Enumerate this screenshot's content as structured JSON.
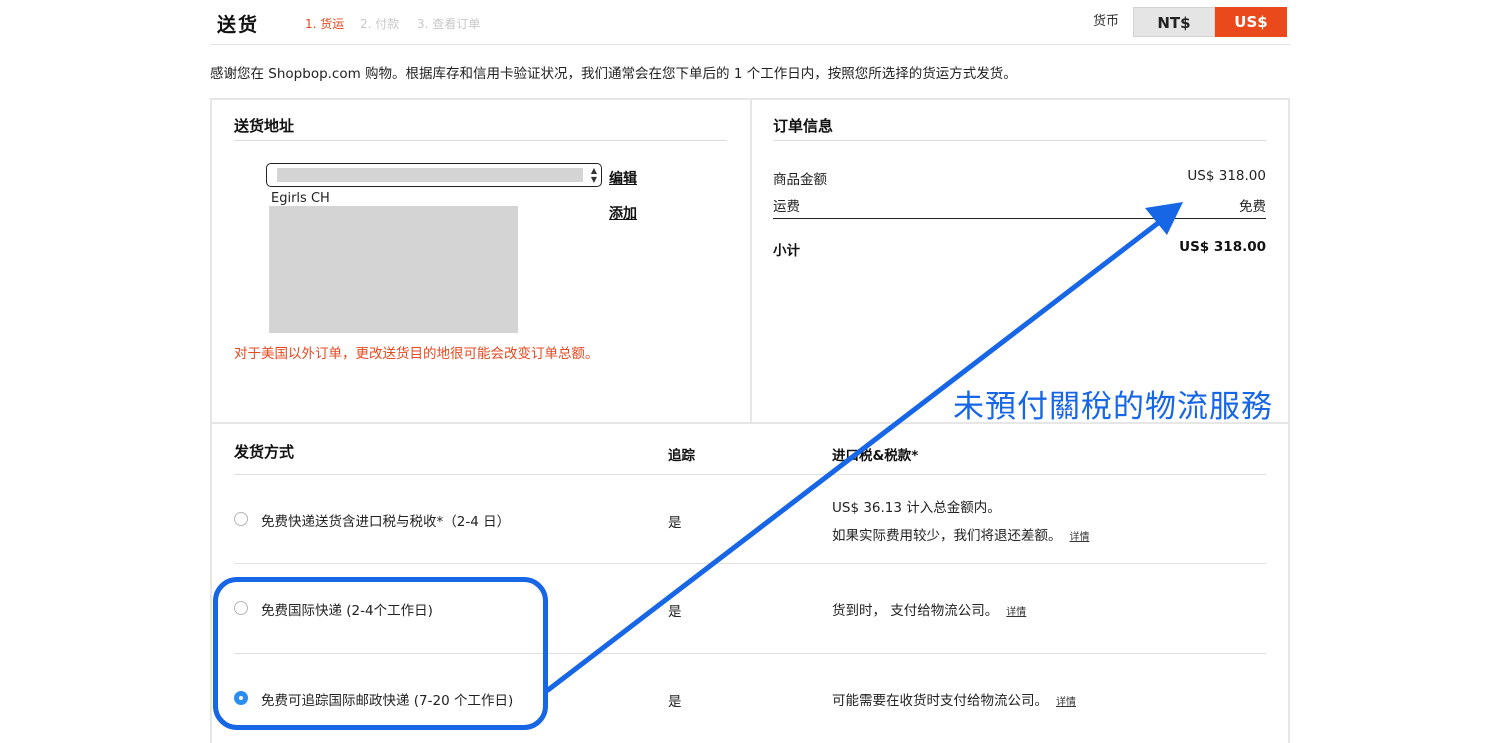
{
  "header": {
    "title": "送货",
    "steps": [
      "1. 货运",
      "2. 付款",
      "3. 查看订单"
    ],
    "currency_label": "货币",
    "currency_options": [
      "NT$",
      "US$"
    ],
    "selected_currency": "US$"
  },
  "intro": "感谢您在 Shopbop.com 购物。根据库存和信用卡验证状况，我们通常会在您下单后的 1 个工作日内，按照您所选择的货运方式发货。",
  "address": {
    "title": "送货地址",
    "edit_label": "编辑",
    "add_label": "添加",
    "name": "Egirls CH",
    "warning": "对于美国以外订单，更改送货目的地很可能会改变订单总额。"
  },
  "order_info": {
    "title": "订单信息",
    "rows": [
      {
        "label": "商品金额",
        "value": "US$ 318.00"
      },
      {
        "label": "运费",
        "value": "免费"
      }
    ],
    "subtotal_label": "小计",
    "subtotal_value": "US$ 318.00"
  },
  "shipping": {
    "title": "发货方式",
    "col_tracking": "追踪",
    "col_tax": "进口税&税款*",
    "detail_label": "详情",
    "options": [
      {
        "label": "免费快递送货含进口税与税收*（2-4 日）",
        "tracking": "是",
        "tax_line1": "US$ 36.13 计入总金额内。",
        "tax_line2": "如果实际费用较少，我们将退还差额。",
        "selected": false
      },
      {
        "label": "免费国际快递 (2-4个工作日)",
        "tracking": "是",
        "tax_line1": "货到时， 支付给物流公司。",
        "selected": false
      },
      {
        "label": "免费可追踪国际邮政快递 (7-20 个工作日)",
        "tracking": "是",
        "tax_line1": "可能需要在收货时支付给物流公司。",
        "selected": true
      }
    ]
  },
  "annotation": {
    "text": "未預付關稅的物流服務",
    "color": "#1766e6"
  },
  "colors": {
    "accent": "#ea4a1b",
    "radio_selected": "#2a8ef0"
  }
}
